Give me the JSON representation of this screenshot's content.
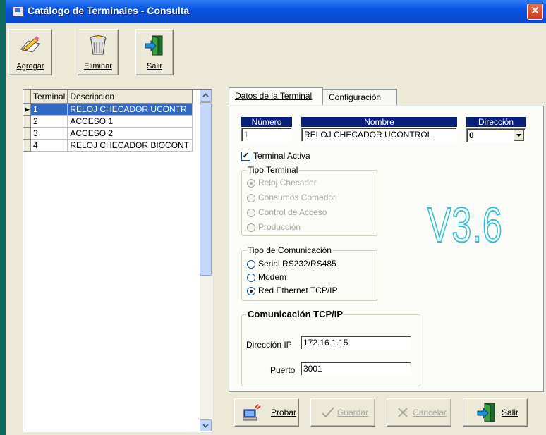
{
  "window": {
    "title": "Catálogo de Terminales - Consulta",
    "close_label": "✕"
  },
  "toolbar": {
    "add": "Agregar",
    "delete": "Eliminar",
    "exit": "Salir"
  },
  "grid": {
    "headers": [
      "Terminal",
      "Descripcion"
    ],
    "rows": [
      {
        "indicator": "▶",
        "num": "1",
        "desc": "RELOJ CHECADOR UCONTR"
      },
      {
        "indicator": "",
        "num": "2",
        "desc": "ACCESO 1"
      },
      {
        "indicator": "",
        "num": "3",
        "desc": "ACCESO 2"
      },
      {
        "indicator": "",
        "num": "4",
        "desc": "RELOJ CHECADOR BIOCONT"
      }
    ]
  },
  "tabs": {
    "datos": "Datos de la Terminal",
    "config": "Configuración"
  },
  "form": {
    "numero_label": "Número",
    "numero_value": "1",
    "nombre_label": "Nombre",
    "nombre_value": "RELOJ CHECADOR UCONTROL",
    "direccion_label": "Dirección",
    "direccion_value": "0",
    "terminal_activa": "Terminal Activa",
    "terminal_activa_checked": true,
    "tipo_terminal": {
      "legend": "Tipo Terminal",
      "options": [
        "Reloj Checador",
        "Consumos Comedor",
        "Control de Acceso",
        "Producción"
      ],
      "selected": "Reloj Checador"
    },
    "tipo_comunicacion": {
      "legend": "Tipo de Comunicación",
      "options": [
        "Serial RS232/RS485",
        "Modem",
        "Red Ethernet TCP/IP"
      ],
      "selected": "Red Ethernet TCP/IP"
    },
    "tcp": {
      "legend": "Comunicación TCP/IP",
      "ip_label": "Dirección IP",
      "ip_value": "172.16.1.15",
      "port_label": "Puerto",
      "port_value": "3001"
    }
  },
  "version_badge": "V3.6",
  "buttons": {
    "probar": "Probar",
    "guardar": "Guardar",
    "cancelar": "Cancelar",
    "salir": "Salir"
  }
}
